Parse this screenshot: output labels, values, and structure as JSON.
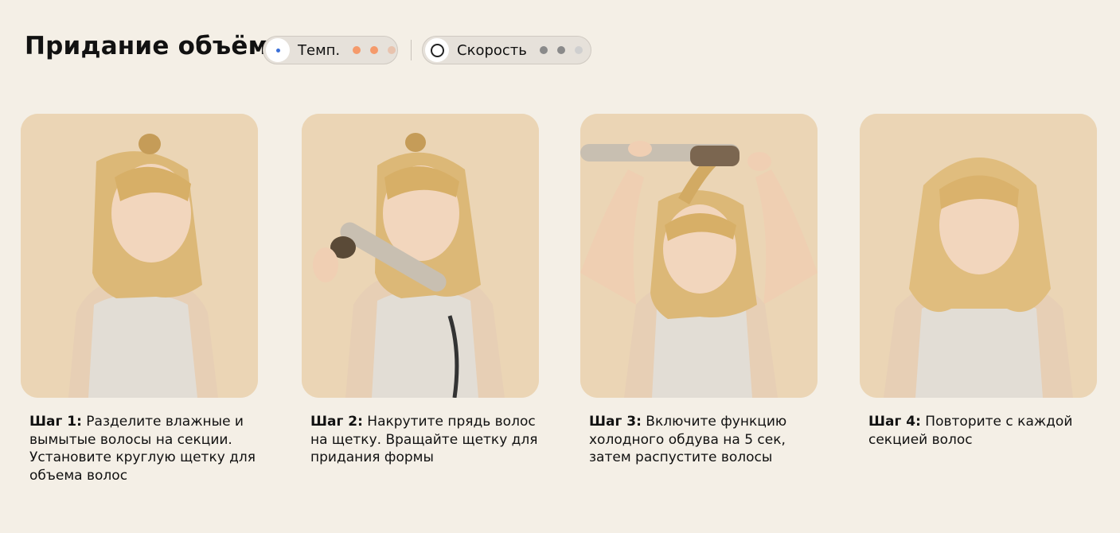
{
  "header": {
    "title": "Придание объёма",
    "temperature": {
      "label": "Темп.",
      "dot_colors": [
        "#f59a6b",
        "#f59a6b",
        "#e8c3ae"
      ]
    },
    "speed": {
      "label": "Скорость",
      "dot_colors": [
        "#8a8a8a",
        "#8a8a8a",
        "#cfcfcf"
      ]
    }
  },
  "colors": {
    "background": "#f4efe6",
    "card_background": "#ead5b6",
    "pill_background": "#e6e1da"
  },
  "steps": [
    {
      "label": "Шаг 1:",
      "text": " Разделите влажные и вымытые волосы на секции. Установите круглую щетку для объема волос",
      "image": "woman-profile-hair-in-bun-photo"
    },
    {
      "label": "Шаг 2:",
      "text": " Накрутите прядь волос на щетку. Вращайте щетку для придания формы",
      "image": "woman-rolling-hair-on-brush-photo"
    },
    {
      "label": "Шаг 3:",
      "text": " Включите функцию холодного обдува на 5 сек, затем распустите волосы",
      "image": "woman-holding-brush-overhead-photo"
    },
    {
      "label": "Шаг 4:",
      "text": " Повторите с каждой секцией волос",
      "image": "woman-finished-voluminous-hair-photo"
    }
  ]
}
